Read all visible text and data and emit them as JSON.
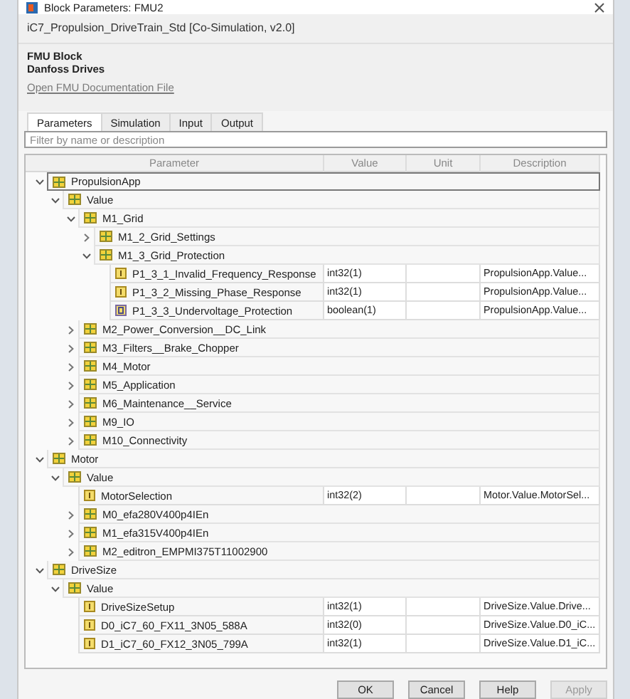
{
  "window": {
    "title": "Block Parameters: FMU2"
  },
  "header": {
    "model": "iC7_Propulsion_DriveTrain_Std [Co-Simulation, v2.0]",
    "lines": [
      "FMU Block",
      "Danfoss Drives"
    ],
    "link": "Open FMU Documentation File"
  },
  "tabs": [
    {
      "label": "Parameters",
      "selected": true
    },
    {
      "label": "Simulation",
      "selected": false
    },
    {
      "label": "Input",
      "selected": false
    },
    {
      "label": "Output",
      "selected": false
    }
  ],
  "filter": {
    "placeholder": "Filter by name or description"
  },
  "table": {
    "columns": [
      "Parameter",
      "Value",
      "Unit",
      "Description"
    ],
    "tree": [
      {
        "kind": "group",
        "name": "PropulsionApp",
        "expanded": true,
        "selected": true,
        "children": [
          {
            "kind": "group",
            "name": "Value",
            "expanded": true,
            "selected": false,
            "children": [
              {
                "kind": "group",
                "name": "M1_Grid",
                "expanded": true,
                "selected": false,
                "children": [
                  {
                    "kind": "group",
                    "name": "M1_2_Grid_Settings",
                    "expanded": false,
                    "selected": false
                  },
                  {
                    "kind": "group",
                    "name": "M1_3_Grid_Protection",
                    "expanded": true,
                    "selected": false,
                    "children": [
                      {
                        "kind": "integer",
                        "name": "P1_3_1_Invalid_Frequency_Response",
                        "value": "int32(1)",
                        "description": "PropulsionApp.Value...",
                        "selected": false
                      },
                      {
                        "kind": "integer",
                        "name": "P1_3_2_Missing_Phase_Response",
                        "value": "int32(1)",
                        "description": "PropulsionApp.Value...",
                        "selected": false
                      },
                      {
                        "kind": "boolean",
                        "name": "P1_3_3_Undervoltage_Protection",
                        "value": "boolean(1)",
                        "description": "PropulsionApp.Value...",
                        "selected": false
                      }
                    ]
                  }
                ]
              },
              {
                "kind": "group",
                "name": "M2_Power_Conversion__DC_Link",
                "expanded": false,
                "selected": false
              },
              {
                "kind": "group",
                "name": "M3_Filters__Brake_Chopper",
                "expanded": false,
                "selected": false
              },
              {
                "kind": "group",
                "name": "M4_Motor",
                "expanded": false,
                "selected": false
              },
              {
                "kind": "group",
                "name": "M5_Application",
                "expanded": false,
                "selected": false
              },
              {
                "kind": "group",
                "name": "M6_Maintenance__Service",
                "expanded": false,
                "selected": false
              },
              {
                "kind": "group",
                "name": "M9_IO",
                "expanded": false,
                "selected": false
              },
              {
                "kind": "group",
                "name": "M10_Connectivity",
                "expanded": false,
                "selected": false
              }
            ]
          }
        ]
      },
      {
        "kind": "group",
        "name": "Motor",
        "expanded": true,
        "selected": false,
        "children": [
          {
            "kind": "group",
            "name": "Value",
            "expanded": true,
            "selected": false,
            "children": [
              {
                "kind": "integer",
                "name": "MotorSelection",
                "value": "int32(2)",
                "description": "Motor.Value.MotorSel...",
                "selected": false
              },
              {
                "kind": "group",
                "name": "M0_efa280V400p4IEn",
                "expanded": false,
                "selected": false
              },
              {
                "kind": "group",
                "name": "M1_efa315V400p4IEn",
                "expanded": false,
                "selected": false
              },
              {
                "kind": "group",
                "name": "M2_editron_EMPMI375T11002900",
                "expanded": false,
                "selected": false
              }
            ]
          }
        ]
      },
      {
        "kind": "group",
        "name": "DriveSize",
        "expanded": true,
        "selected": false,
        "children": [
          {
            "kind": "group",
            "name": "Value",
            "expanded": true,
            "selected": false,
            "children": [
              {
                "kind": "integer",
                "name": "DriveSizeSetup",
                "value": "int32(1)",
                "description": "DriveSize.Value.Drive...",
                "selected": false
              },
              {
                "kind": "integer",
                "name": "D0_iC7_60_FX11_3N05_588A",
                "value": "int32(0)",
                "description": "DriveSize.Value.D0_iC...",
                "selected": false
              },
              {
                "kind": "integer",
                "name": "D1_iC7_60_FX12_3N05_799A",
                "value": "int32(1)",
                "description": "DriveSize.Value.D1_iC...",
                "selected": false
              }
            ]
          }
        ]
      }
    ]
  },
  "buttons": [
    {
      "label": "OK",
      "disabled": false
    },
    {
      "label": "Cancel",
      "disabled": false
    },
    {
      "label": "Help",
      "disabled": false
    },
    {
      "label": "Apply",
      "disabled": true
    }
  ]
}
